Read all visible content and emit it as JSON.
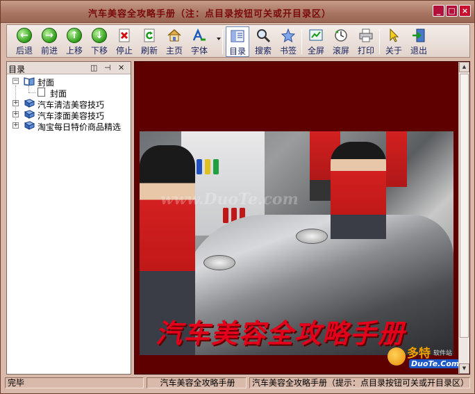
{
  "window": {
    "title": "汽车美容全攻略手册（注：点目录按钮可关或开目录区）",
    "controls": {
      "minimize": "_",
      "maximize": "□",
      "close": "×"
    }
  },
  "toolbar": {
    "buttons": [
      {
        "label": "后退",
        "icon": "back-arrow-icon"
      },
      {
        "label": "前进",
        "icon": "forward-arrow-icon"
      },
      {
        "label": "上移",
        "icon": "up-arrow-icon"
      },
      {
        "label": "下移",
        "icon": "down-arrow-icon"
      },
      {
        "label": "停止",
        "icon": "stop-icon"
      },
      {
        "label": "刷新",
        "icon": "refresh-icon"
      },
      {
        "label": "主页",
        "icon": "home-icon"
      },
      {
        "label": "字体",
        "icon": "font-icon"
      },
      {
        "label": "目录",
        "icon": "contents-icon",
        "active": true
      },
      {
        "label": "搜索",
        "icon": "search-icon"
      },
      {
        "label": "书签",
        "icon": "bookmark-star-icon"
      },
      {
        "label": "全屏",
        "icon": "fullscreen-icon"
      },
      {
        "label": "滚屏",
        "icon": "autoscroll-icon"
      },
      {
        "label": "打印",
        "icon": "printer-icon"
      },
      {
        "label": "关于",
        "icon": "about-pointer-icon"
      },
      {
        "label": "退出",
        "icon": "exit-icon"
      }
    ]
  },
  "sidebar": {
    "title": "目录",
    "controls": {
      "pin": "◫",
      "dock": "⊣",
      "close": "✕"
    },
    "tree": [
      {
        "label": "封面",
        "expanded": true,
        "children": [
          {
            "label": "封面"
          }
        ]
      },
      {
        "label": "汽车清洁美容技巧",
        "expanded": false
      },
      {
        "label": "汽车漆面美容技巧",
        "expanded": false
      },
      {
        "label": "淘宝每日特价商品精选",
        "expanded": false
      }
    ]
  },
  "content": {
    "cover_title": "汽车美容全攻略手册",
    "watermark": "www.DuoTe.com",
    "logo": {
      "cn": "多特",
      "small": "软件站",
      "en": "DuoTe.Com"
    }
  },
  "statusbar": {
    "status": "完毕",
    "book": "汽车美容全攻略手册",
    "hint": "汽车美容全攻略手册（提示：点目录按钮可关或开目录区）"
  },
  "colors": {
    "frame": "#d8b9aa",
    "content_bg": "#5e0000",
    "title_text": "#7a0a0a",
    "cover_title": "#e3001b",
    "toolbar_label": "#1a2460"
  }
}
